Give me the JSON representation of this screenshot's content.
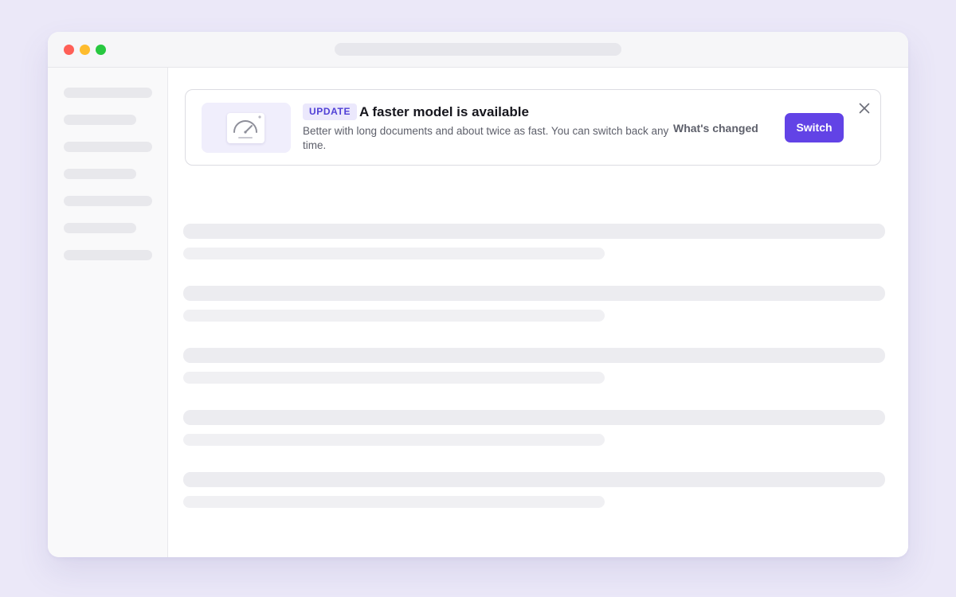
{
  "banner": {
    "badge": "UPDATE",
    "title": "A faster model is available",
    "description": "Better with long documents and about twice as fast. You can switch back any time.",
    "secondary_action": "What's changed",
    "primary_action": "Switch",
    "illustration_icon": "speedometer-icon",
    "close_icon": "close-icon"
  },
  "colors": {
    "accent": "#6243e6",
    "badge_bg": "#ebe8fc",
    "badge_text": "#4f3fd6",
    "page_bg": "#ebe8f8"
  }
}
